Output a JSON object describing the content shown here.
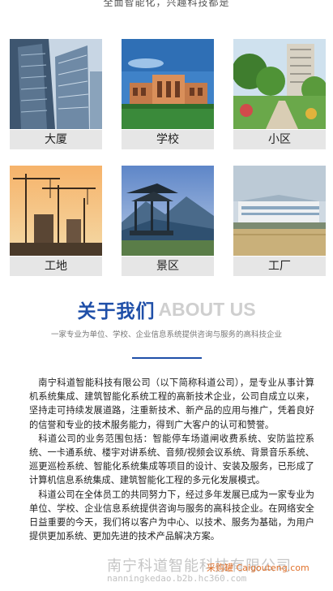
{
  "top_text": "全面智能化，兴趣科技都是",
  "categories": [
    {
      "label": "大厦",
      "icon": "office-building-photo"
    },
    {
      "label": "学校",
      "icon": "school-building-photo"
    },
    {
      "label": "小区",
      "icon": "residential-garden-photo"
    },
    {
      "label": "工地",
      "icon": "construction-cranes-photo"
    },
    {
      "label": "景区",
      "icon": "scenic-pavilion-photo"
    },
    {
      "label": "工厂",
      "icon": "factory-photo"
    }
  ],
  "about": {
    "title_cn": "关于我们",
    "title_en": "ABOUT US",
    "subtitle": "一家专业为单位、学校、企业信息系统提供咨询与服务的高科技企业",
    "accent_color": "#1f4fa8"
  },
  "intro_paragraphs": [
    "南宁科道智能科技有限公司（以下简称科道公司），是专业从事计算机系统集成、建筑智能化系统工程的高新技术企业，公司自成立以来，坚持走可持续发展道路，注重新技术、新产品的应用与推广，凭着良好的信誉和专业的技术服务能力，得到广大客户的认可和赞誉。",
    "科道公司的业务范围包括：智能停车场道闸收费系统、安防监控系统、一卡通系统、楼宇对讲系统、音频/视频会议系统、背景音乐系统、巡更巡检系统、智能化系统集成等项目的设计、安装及服务，已形成了计算机信息系统集成、建筑智能化工程的多元化发展模式。",
    "科道公司在全体员工的共同努力下，经过多年发展已成为一家专业为单位、学校、企业信息系统提供咨询与服务的高科技企业。在网络安全日益重要的今天，我们将以客户为中心、以技术、服务为基础，为用户提供更加系统、更加先进的技术产品解决方案。"
  ],
  "watermark": {
    "company": "南宁科道智能科技有限公司",
    "domain": "nanningkedao.b2b.hc360.com",
    "badge": "采购罐 Caigouteng.com"
  }
}
